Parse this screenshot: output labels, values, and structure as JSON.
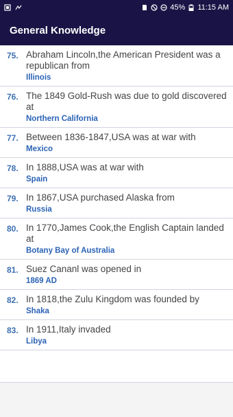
{
  "status_bar": {
    "battery": "45%",
    "time": "11:15 AM"
  },
  "app_bar": {
    "title": "General Knowledge"
  },
  "items": [
    {
      "num": "75.",
      "question": "Abraham Lincoln,the American President was a republican from",
      "answer": "Illinois"
    },
    {
      "num": "76.",
      "question": "The 1849 Gold-Rush was due to gold discovered at",
      "answer": "Northern California"
    },
    {
      "num": "77.",
      "question": "Between 1836-1847,USA was at war with",
      "answer": "Mexico"
    },
    {
      "num": "78.",
      "question": "In 1888,USA was at war with",
      "answer": "Spain"
    },
    {
      "num": "79.",
      "question": "In 1867,USA purchased Alaska from",
      "answer": "Russia"
    },
    {
      "num": "80.",
      "question": "In 1770,James Cook,the English Captain landed at",
      "answer": "Botany Bay of Australia"
    },
    {
      "num": "81.",
      "question": "Suez Cananl was opened in",
      "answer": "1869 AD"
    },
    {
      "num": "82.",
      "question": "In 1818,the Zulu Kingdom was founded by",
      "answer": "Shaka"
    },
    {
      "num": "83.",
      "question": "In 1911,Italy invaded",
      "answer": "Libya"
    }
  ]
}
